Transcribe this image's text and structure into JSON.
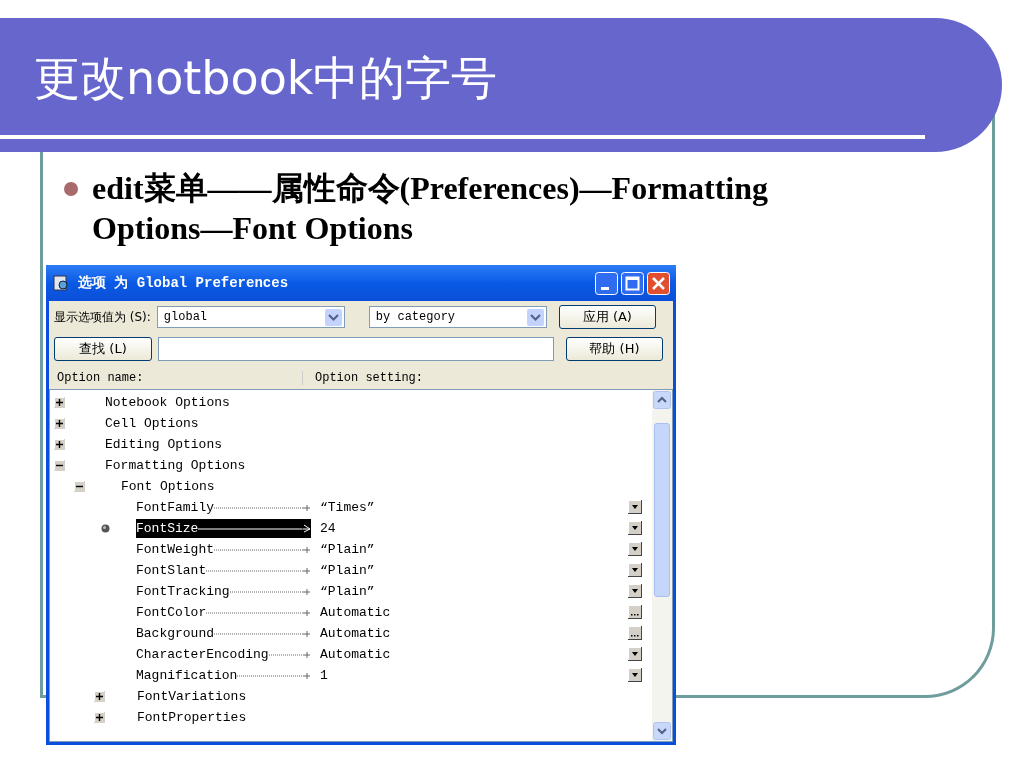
{
  "slide": {
    "title": "更改notbook中的字号",
    "bullet": "edit菜单——属性命令(Preferences)—Formatting Options—Font Options"
  },
  "window": {
    "title": "选项 为 Global Preferences",
    "show_values_label": "显示选项值为 (S):",
    "scope_select": "global",
    "view_select": "by category",
    "apply_button": "应用 (A)",
    "find_button": "查找 (L)",
    "help_button": "帮助 (H)",
    "columns": [
      "Option name:",
      "Option setting:"
    ],
    "tree": [
      {
        "kind": "group",
        "name": "Notebook Options",
        "expanded": false
      },
      {
        "kind": "group",
        "name": "Cell Options",
        "expanded": false
      },
      {
        "kind": "group",
        "name": "Editing Options",
        "expanded": false
      },
      {
        "kind": "group",
        "name": "Formatting Options",
        "expanded": true,
        "children": [
          {
            "kind": "group",
            "name": "Font Options",
            "expanded": true,
            "children": [
              {
                "kind": "dropdown",
                "name": "FontFamily",
                "value": "“Times”",
                "selected": false
              },
              {
                "kind": "dropdown",
                "name": "FontSize",
                "value": "24",
                "selected": true
              },
              {
                "kind": "dropdown",
                "name": "FontWeight",
                "value": "“Plain”",
                "selected": false
              },
              {
                "kind": "dropdown",
                "name": "FontSlant",
                "value": "“Plain”",
                "selected": false
              },
              {
                "kind": "dropdown",
                "name": "FontTracking",
                "value": "“Plain”",
                "selected": false
              },
              {
                "kind": "ellipsis",
                "name": "FontColor",
                "value": "Automatic",
                "selected": false
              },
              {
                "kind": "ellipsis",
                "name": "Background",
                "value": "Automatic",
                "selected": false
              },
              {
                "kind": "dropdown",
                "name": "CharacterEncoding",
                "value": "Automatic",
                "selected": false
              },
              {
                "kind": "dropdown",
                "name": "Magnification",
                "value": "1",
                "selected": false
              },
              {
                "kind": "group",
                "name": "FontVariations",
                "expanded": false
              },
              {
                "kind": "group",
                "name": "FontProperties",
                "expanded": false
              }
            ]
          }
        ]
      }
    ]
  }
}
